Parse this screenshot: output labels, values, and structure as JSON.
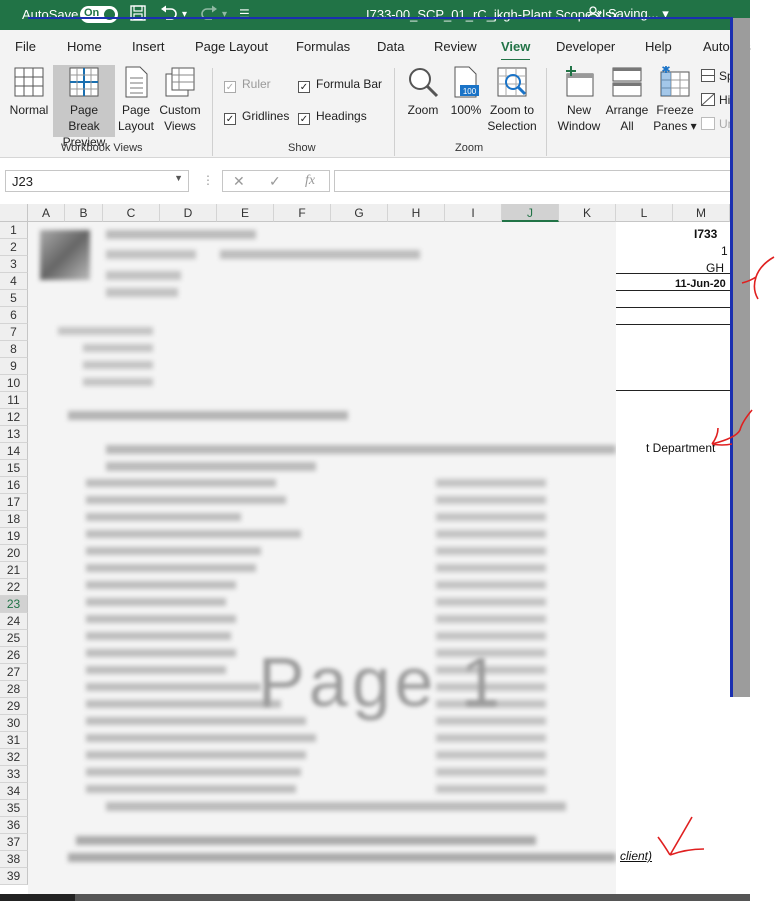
{
  "titlebar": {
    "autosave_label": "AutoSave",
    "toggle_state": "On",
    "filename": "I733-00_SCP_01_rC_jkgh-Plant Scope.xlsx",
    "status": "Saving... ▾"
  },
  "menu": {
    "tabs": [
      "File",
      "Home",
      "Insert",
      "Page Layout",
      "Formulas",
      "Data",
      "Review",
      "View",
      "Developer",
      "Help",
      "Autodes"
    ],
    "active": "View"
  },
  "ribbon": {
    "workbook_views": {
      "label": "Workbook Views",
      "normal": "Normal",
      "page_break_1": "Page Break",
      "page_break_2": "Preview",
      "page_layout_1": "Page",
      "page_layout_2": "Layout",
      "custom_1": "Custom",
      "custom_2": "Views"
    },
    "show": {
      "label": "Show",
      "ruler": "Ruler",
      "formula_bar": "Formula Bar",
      "gridlines": "Gridlines",
      "headings": "Headings"
    },
    "zoom": {
      "label": "Zoom",
      "zoom": "Zoom",
      "hundred": "100%",
      "hundred_icon": "100",
      "to_sel_1": "Zoom to",
      "to_sel_2": "Selection"
    },
    "window": {
      "new_1": "New",
      "new_2": "Window",
      "arrange_1": "Arrange",
      "arrange_2": "All",
      "freeze_1": "Freeze",
      "freeze_2": "Panes ▾",
      "split": "Split",
      "hide": "Hide",
      "unhide": "Unhic"
    }
  },
  "formula_bar": {
    "name_box": "J23",
    "fx": "fx",
    "value": ""
  },
  "grid": {
    "columns": [
      "A",
      "B",
      "C",
      "D",
      "E",
      "F",
      "G",
      "H",
      "I",
      "J",
      "K",
      "L",
      "M"
    ],
    "selected_column": "J",
    "rows": [
      "1",
      "2",
      "3",
      "4",
      "5",
      "6",
      "7",
      "8",
      "9",
      "10",
      "11",
      "12",
      "13",
      "14",
      "15",
      "16",
      "17",
      "18",
      "19",
      "20",
      "21",
      "22",
      "23",
      "24",
      "25",
      "26",
      "27",
      "28",
      "29",
      "30",
      "31",
      "32",
      "33",
      "34",
      "35",
      "36",
      "37",
      "38",
      "39"
    ],
    "selected_row": "23"
  },
  "visible_cells": {
    "m1": "I733",
    "m2": "1",
    "m3": "GH",
    "m4": "11-Jun-20",
    "l13": "t Department",
    "l37": "client)"
  },
  "watermark": "Page 1",
  "colors": {
    "excel_green": "#217346",
    "page_break_blue": "#1a2fb0",
    "annotation_red": "#e02020"
  },
  "icons": [
    "save-icon",
    "undo-icon",
    "redo-icon",
    "customize-icon",
    "coauthor-icon",
    "normal-view-icon",
    "page-break-icon",
    "page-layout-icon",
    "custom-views-icon",
    "magnifier-icon",
    "hundred-percent-icon",
    "zoom-selection-icon",
    "new-window-icon",
    "arrange-all-icon",
    "freeze-panes-icon",
    "split-icon",
    "hide-icon",
    "unhide-icon",
    "cancel-icon",
    "confirm-icon",
    "function-icon"
  ]
}
